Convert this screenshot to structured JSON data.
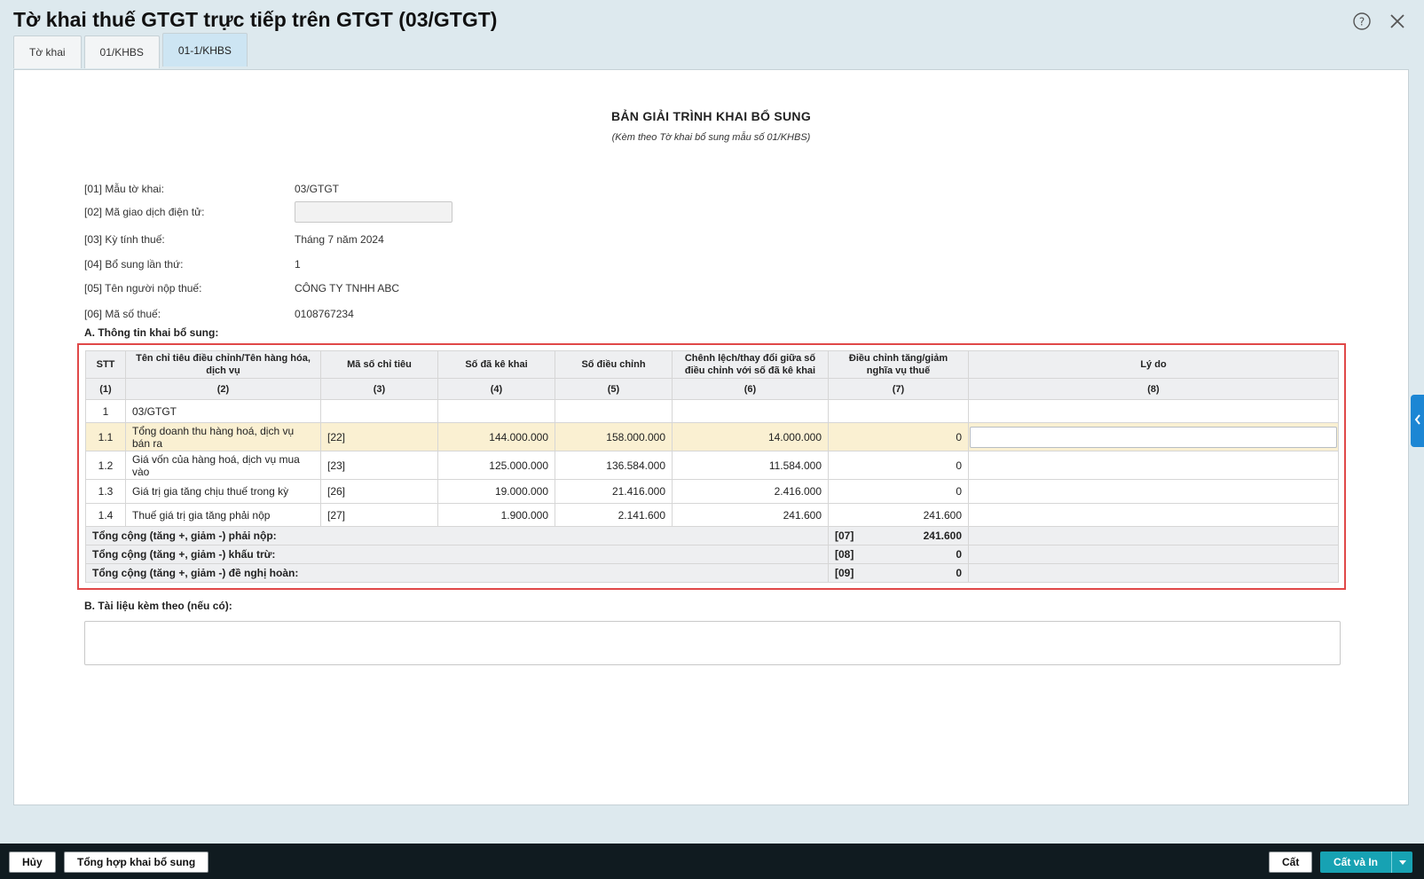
{
  "window": {
    "title": "Tờ khai thuế GTGT trực tiếp trên GTGT (03/GTGT)"
  },
  "icons": {
    "help": "help-icon",
    "close": "close-icon",
    "side_handle": "chevron-left-icon",
    "dropdown": "caret-down-icon"
  },
  "tabs": [
    {
      "label": "Tờ khai"
    },
    {
      "label": "01/KHBS"
    },
    {
      "label": "01-1/KHBS"
    }
  ],
  "document": {
    "title": "BẢN GIẢI TRÌNH KHAI BỔ SUNG",
    "subtitle": "(Kèm theo Tờ khai bổ sung mẫu số 01/KHBS)"
  },
  "fields": {
    "f01": {
      "label": "[01] Mẫu tờ khai:",
      "value": "03/GTGT"
    },
    "f02": {
      "label": "[02] Mã giao dịch điện tử:",
      "value": ""
    },
    "f03": {
      "label": "[03] Kỳ tính thuế:",
      "value": "Tháng 7 năm 2024"
    },
    "f04": {
      "label": "[04] Bổ sung lần thứ:",
      "value": "1"
    },
    "f05": {
      "label": "[05] Tên người nộp thuế:",
      "value": "CÔNG TY TNHH ABC"
    },
    "f06": {
      "label": "[06] Mã số thuế:",
      "value": "0108767234"
    }
  },
  "section_a": {
    "title": "A. Thông tin khai bổ sung:",
    "headers": [
      "STT",
      "Tên chỉ tiêu điều chỉnh/Tên hàng hóa, dịch vụ",
      "Mã số chỉ tiêu",
      "Số đã kê khai",
      "Số điều chỉnh",
      "Chênh lệch/thay đổi giữa số điều chỉnh với số đã kê khai",
      "Điều chỉnh tăng/giảm nghĩa vụ thuế",
      "Lý do"
    ],
    "header_nums": [
      "(1)",
      "(2)",
      "(3)",
      "(4)",
      "(5)",
      "(6)",
      "(7)",
      "(8)"
    ],
    "group": {
      "stt": "1",
      "name": "03/GTGT"
    },
    "rows": [
      {
        "stt": "1.1",
        "name": "Tổng doanh thu hàng hoá, dịch vụ bán ra",
        "code": "[22]",
        "declared": "144.000.000",
        "adjusted": "158.000.000",
        "diff": "14.000.000",
        "obligation": "0",
        "reason": ""
      },
      {
        "stt": "1.2",
        "name": "Giá vốn của hàng hoá, dịch vụ mua vào",
        "code": "[23]",
        "declared": "125.000.000",
        "adjusted": "136.584.000",
        "diff": "11.584.000",
        "obligation": "0",
        "reason": ""
      },
      {
        "stt": "1.3",
        "name": "Giá trị gia tăng chịu thuế trong kỳ",
        "code": "[26]",
        "declared": "19.000.000",
        "adjusted": "21.416.000",
        "diff": "2.416.000",
        "obligation": "0",
        "reason": ""
      },
      {
        "stt": "1.4",
        "name": "Thuế giá trị gia tăng phải nộp",
        "code": "[27]",
        "declared": "1.900.000",
        "adjusted": "2.141.600",
        "diff": "241.600",
        "obligation": "241.600",
        "reason": ""
      }
    ],
    "totals": [
      {
        "label": "Tổng cộng (tăng +, giảm -) phải nộp:",
        "code": "[07]",
        "value": "241.600"
      },
      {
        "label": "Tổng cộng (tăng +, giảm -) khấu trừ:",
        "code": "[08]",
        "value": "0"
      },
      {
        "label": "Tổng cộng (tăng +, giảm -) đề nghị hoàn:",
        "code": "[09]",
        "value": "0"
      }
    ]
  },
  "section_b": {
    "title": "B. Tài liệu kèm theo (nếu có):",
    "value": ""
  },
  "footer": {
    "cancel": "Hủy",
    "summary": "Tổng hợp khai bổ sung",
    "save": "Cất",
    "save_print": "Cất và In"
  },
  "colors": {
    "highlight_frame": "#e04848",
    "selected_row": "#faf0d2",
    "primary_button": "#17a2b3",
    "active_tab": "#cde5f3",
    "side_handle": "#1c86d4"
  }
}
